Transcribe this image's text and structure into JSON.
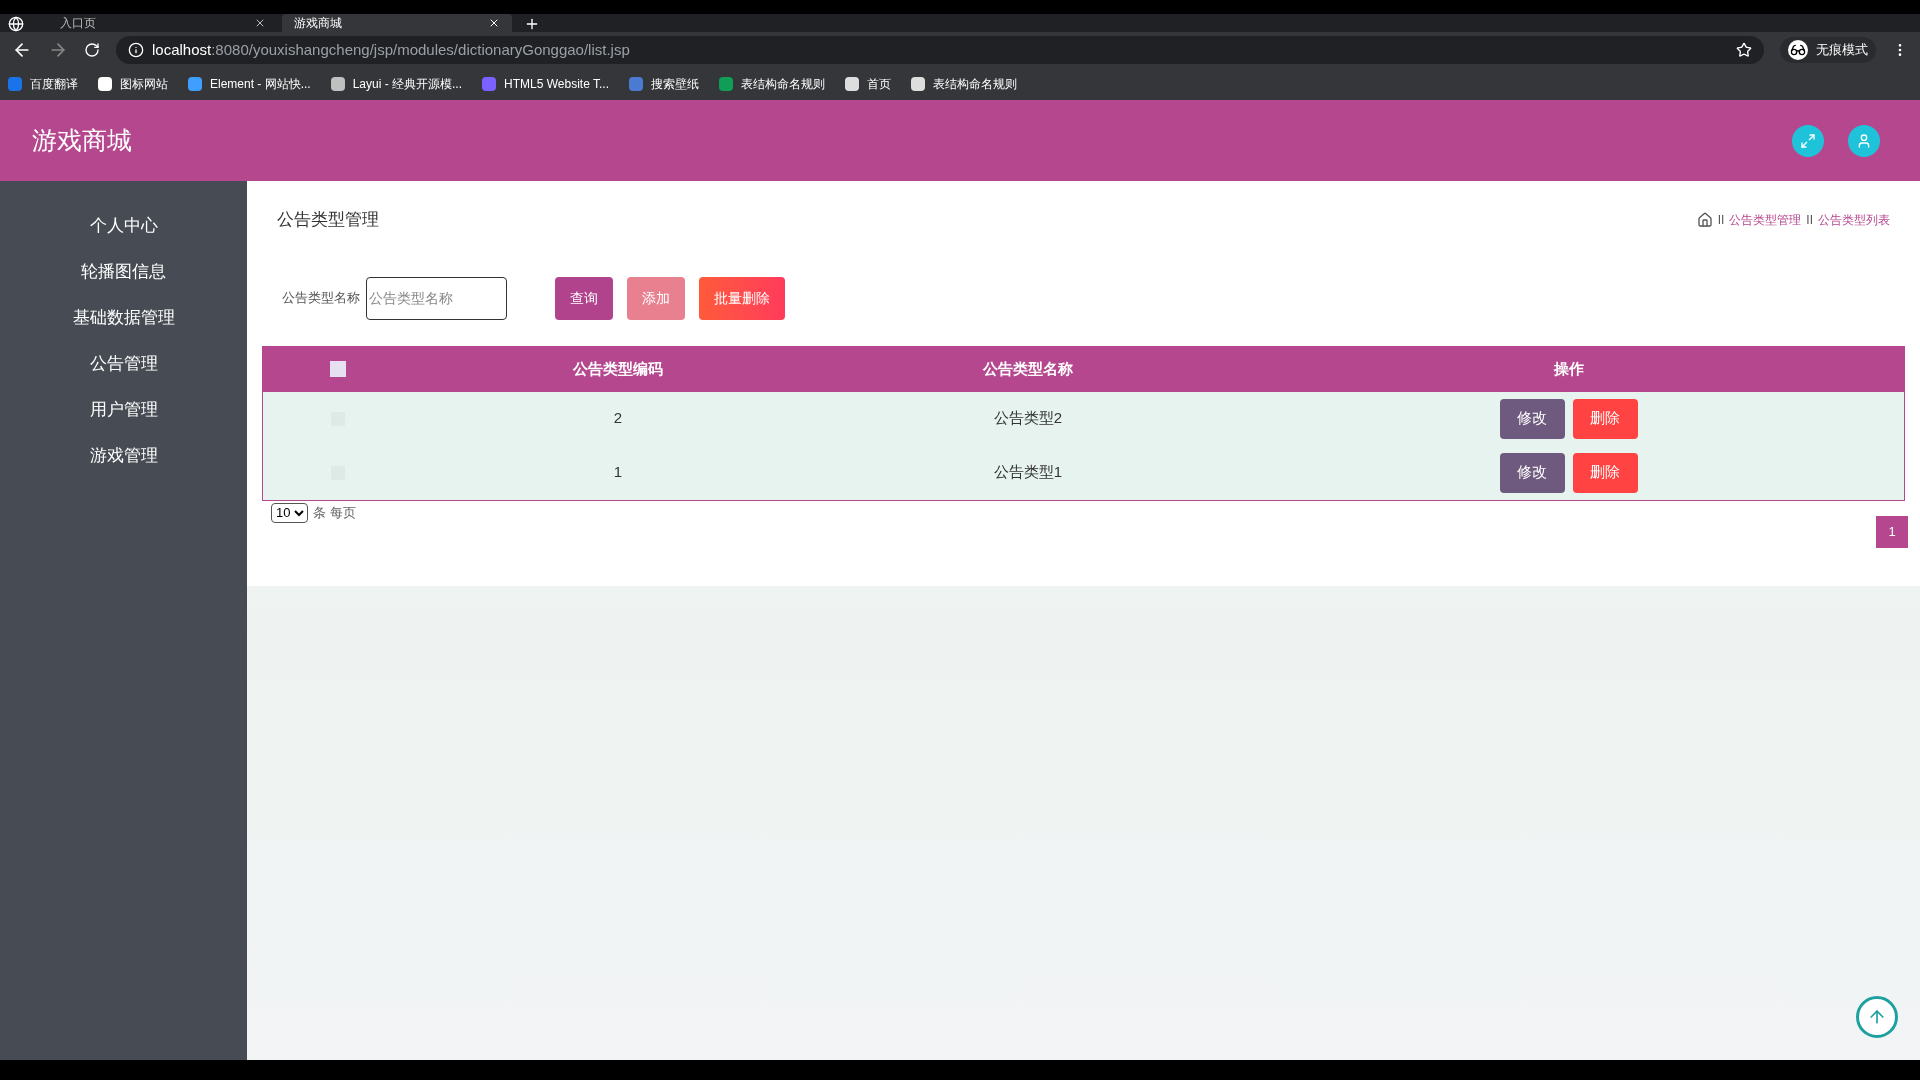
{
  "browser": {
    "tabs": [
      {
        "title": "入口页",
        "selected": false
      },
      {
        "title": "游戏商城",
        "selected": true
      }
    ],
    "url_host": "localhost",
    "url_rest": ":8080/youxishangcheng/jsp/modules/dictionaryGonggao/list.jsp",
    "profile": "无痕模式",
    "bookmarks": [
      {
        "label": "百度翻译",
        "color": "#1a73e8"
      },
      {
        "label": "图标网站",
        "color": "#ffffff"
      },
      {
        "label": "Element - 网站快...",
        "color": "#409eff"
      },
      {
        "label": "Layui - 经典开源模...",
        "color": "#c0c0c0"
      },
      {
        "label": "HTML5 Website T...",
        "color": "#7b61ff"
      },
      {
        "label": "搜索壁纸",
        "color": "#4a7bd0"
      },
      {
        "label": "表结构命名规则",
        "color": "#0f9d58"
      },
      {
        "label": "首页",
        "color": "#dddddd"
      },
      {
        "label": "表结构命名规则",
        "color": "#dddddd"
      }
    ]
  },
  "app": {
    "title": "游戏商城"
  },
  "sidebar": {
    "items": [
      {
        "label": "个人中心"
      },
      {
        "label": "轮播图信息"
      },
      {
        "label": "基础数据管理"
      },
      {
        "label": "公告管理"
      },
      {
        "label": "用户管理"
      },
      {
        "label": "游戏管理"
      }
    ]
  },
  "page": {
    "title": "公告类型管理",
    "breadcrumb": [
      "公告类型管理",
      "公告类型列表"
    ],
    "separators": [
      "II",
      "II"
    ]
  },
  "search": {
    "label": "公告类型名称",
    "placeholder": "公告类型名称"
  },
  "buttons": [
    {
      "label": "查询",
      "kind": "query"
    },
    {
      "label": "添加",
      "kind": "add"
    },
    {
      "label": "批量删除",
      "kind": "batch_delete"
    }
  ],
  "table": {
    "select_all_checked": false,
    "columns": [
      "公告类型编码",
      "公告类型名称",
      "操作"
    ],
    "rows": [
      {
        "checked": false,
        "code": "2",
        "name": "公告类型2",
        "actions": [
          "修改",
          "删除"
        ]
      },
      {
        "checked": false,
        "code": "1",
        "name": "公告类型1",
        "actions": [
          "修改",
          "删除"
        ]
      }
    ]
  },
  "page_size": {
    "value": "10",
    "suffix": "条 每页"
  },
  "pagination": [
    {
      "label": "1",
      "selected": true
    }
  ]
}
